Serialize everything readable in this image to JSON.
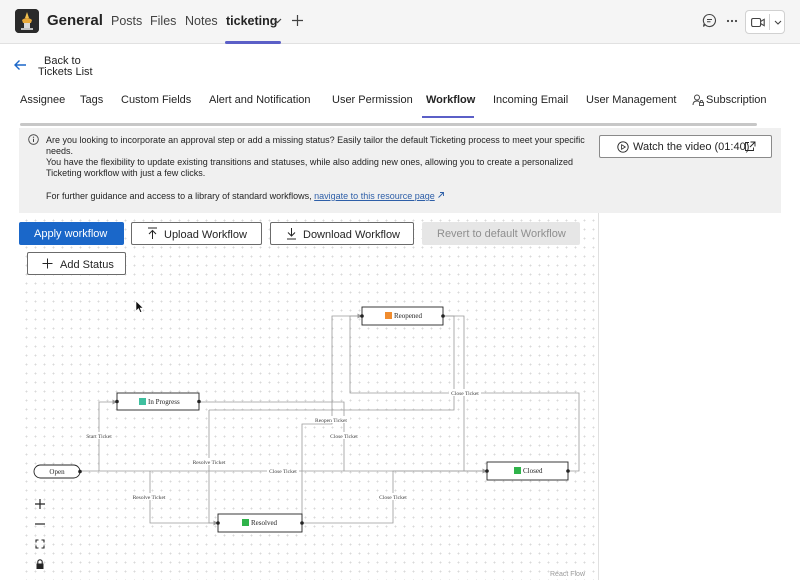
{
  "topbar": {
    "app_name": "General",
    "tabs": [
      {
        "label": "Posts"
      },
      {
        "label": "Files"
      },
      {
        "label": "Notes"
      },
      {
        "label": "ticketing"
      }
    ]
  },
  "back": {
    "line1": "Back to",
    "line2": "Tickets List"
  },
  "subtabs": [
    {
      "label": "Assignee"
    },
    {
      "label": "Tags"
    },
    {
      "label": "Custom Fields"
    },
    {
      "label": "Alert and Notification"
    },
    {
      "label": "User Permission"
    },
    {
      "label": "Workflow"
    },
    {
      "label": "Incoming Email"
    },
    {
      "label": "User Management"
    },
    {
      "label": "Subscription"
    }
  ],
  "banner": {
    "line1": "Are you looking to incorporate an approval step or add a missing status? Easily tailor the default Ticketing process to meet your specific needs.",
    "line2": "You have the flexibility to update existing transitions and statuses, while also adding new ones, allowing you to create a personalized Ticketing workflow with just a few clicks.",
    "line3_prefix": "For further guidance and access to a library of standard workflows,",
    "link": "navigate to this resource page",
    "video_button": "Watch the video (01:40)"
  },
  "buttons": {
    "apply": "Apply workflow",
    "upload": "Upload Workflow",
    "download": "Download Workflow",
    "revert": "Revert to default Workflow",
    "add_status": "Add Status"
  },
  "flow": {
    "nodes": {
      "open": "Open",
      "in_progress": "In Progress",
      "reopened": "Reopened",
      "resolved": "Resolved",
      "closed": "Closed"
    },
    "edges": {
      "start_ticket": "Start Ticket",
      "resolve_ticket_1": "Resolve Ticket",
      "resolve_ticket_2": "Resolve Ticket",
      "close_ticket_1": "Close Ticket",
      "close_ticket_2": "Close Ticket",
      "close_ticket_3": "Close Ticket",
      "close_ticket_4": "Close Ticket",
      "reopen_ticket": "Reopen Ticket"
    },
    "status_colors": {
      "in_progress": "#3fbf9f",
      "reopened": "#f08c2e",
      "resolved": "#2fb34a",
      "closed": "#2fb34a"
    }
  },
  "footer": {
    "react_flow": "React Flow"
  },
  "icons": {
    "back": "arrow-left-icon",
    "info": "info-icon",
    "upload": "upload-icon",
    "download": "download-icon",
    "add": "plus-icon"
  }
}
